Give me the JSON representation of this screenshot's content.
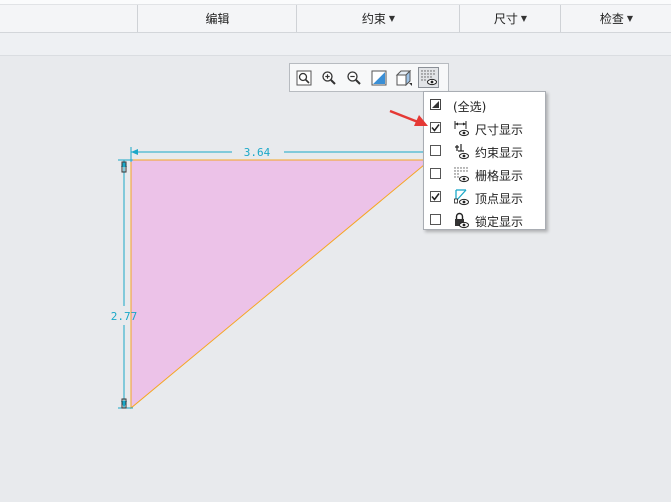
{
  "ribbon": {
    "groups": [
      {
        "label": "编辑",
        "has_caret": false
      },
      {
        "label": "约束",
        "has_caret": true
      },
      {
        "label": "尺寸",
        "has_caret": true
      },
      {
        "label": "检查",
        "has_caret": true
      }
    ]
  },
  "graphics_toolbar": {
    "buttons": [
      "refit-icon",
      "zoom-in-icon",
      "zoom-out-icon",
      "repaint-icon",
      "display-style-icon",
      "sketcher-display-filter-icon"
    ]
  },
  "sketch": {
    "dimension_width": "3.64",
    "dimension_height": "2.77",
    "fill_color": "#ecc2e8",
    "edge_color": "#f5a623",
    "dimension_color": "#1aa8c8"
  },
  "display_filter_menu": {
    "select_all_label": "(全选)",
    "items": [
      {
        "label": "尺寸显示",
        "checked": true,
        "icon": "dimension-display-icon"
      },
      {
        "label": "约束显示",
        "checked": false,
        "icon": "constraint-display-icon"
      },
      {
        "label": "栅格显示",
        "checked": false,
        "icon": "grid-display-icon"
      },
      {
        "label": "顶点显示",
        "checked": true,
        "icon": "vertex-display-icon"
      },
      {
        "label": "锁定显示",
        "checked": false,
        "icon": "lock-display-icon"
      }
    ]
  },
  "annotation": {
    "arrow_color": "#e53935"
  }
}
